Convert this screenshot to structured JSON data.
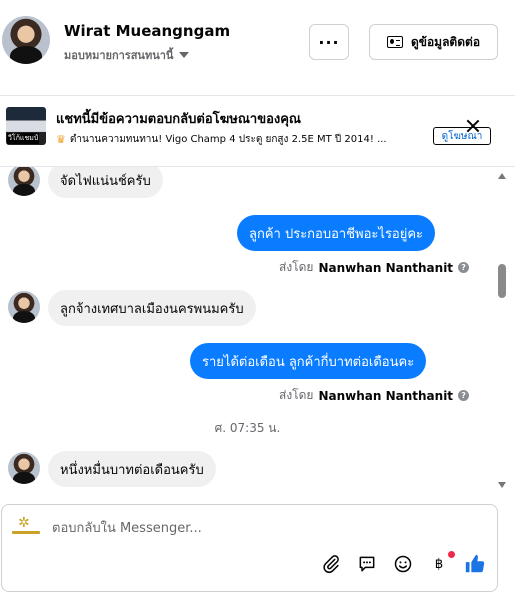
{
  "header": {
    "contact_name": "Wirat Mueangngam",
    "assign_label": "มอบหมายการสนทนานี้",
    "more_label": "···",
    "view_contact_label": "ดูข้อมูลติดต่อ"
  },
  "ad": {
    "thumb_text": "วีโก้แชมป์",
    "title": "แชทนี้มีข้อความตอบกลับต่อโฆษณาของคุณ",
    "description": "ตำนานความทนทาน! Vigo Champ 4 ประตู ยกสูง 2.5E MT ปี 2014! ...",
    "link_label": "ดูโฆษณา"
  },
  "messages": [
    {
      "direction": "in",
      "text": "จัดไฟแน่นช์ครับ"
    },
    {
      "direction": "out",
      "text": "ลูกค้า  ประกอบอาชีพอะไรอยู่คะ",
      "sent_by_prefix": "ส่งโดย",
      "sender": "Nanwhan Nanthanit"
    },
    {
      "direction": "in",
      "text": "ลูกจ้างเทศบาลเมืองนครพนมครับ"
    },
    {
      "direction": "out",
      "text": "รายได้ต่อเดือน  ลูกค้ากี่บาทต่อเดือนคะ",
      "sent_by_prefix": "ส่งโดย",
      "sender": "Nanwhan Nanthanit"
    },
    {
      "direction": "in",
      "text": "หนึ่งหมื่นบาทต่อเดือนครับ"
    }
  ],
  "timestamp": "ศ. 07:35 น.",
  "composer": {
    "placeholder": "ตอบกลับใน Messenger..."
  },
  "toolbar": {
    "icons": [
      "paperclip-icon",
      "quick-reply-icon",
      "emoji-icon",
      "baht-icon",
      "like-icon"
    ]
  },
  "colors": {
    "outgoing_bubble": "#0a7cff",
    "incoming_bubble": "#f0f0f0",
    "like_icon": "#1b74e4",
    "notification_dot": "#f02849"
  }
}
